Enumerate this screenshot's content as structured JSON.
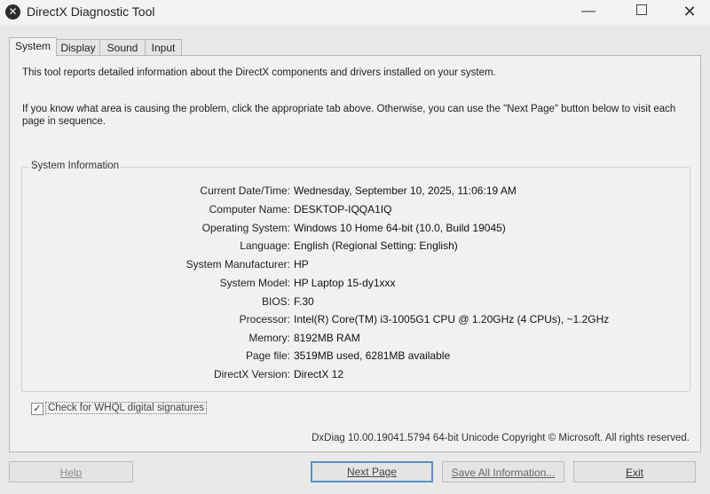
{
  "window": {
    "title": "DirectX Diagnostic Tool",
    "app_icon": "directx-x-icon",
    "controls": {
      "minimize": "—",
      "close": "✕"
    }
  },
  "tabs": [
    {
      "label": "System",
      "active": true
    },
    {
      "label": "Display",
      "active": false
    },
    {
      "label": "Sound",
      "active": false
    },
    {
      "label": "Input",
      "active": false
    }
  ],
  "intro": {
    "line1": "This tool reports detailed information about the DirectX components and drivers installed on your system.",
    "line2": "If you know what area is causing the problem, click the appropriate tab above.  Otherwise, you can use the \"Next Page\" button below to visit each page in sequence."
  },
  "system_info": {
    "group_label": "System Information",
    "rows": [
      {
        "label": "Current Date/Time:",
        "value": "Wednesday, September 10, 2025, 11:06:19 AM"
      },
      {
        "label": "Computer Name:",
        "value": "DESKTOP-IQQA1IQ"
      },
      {
        "label": "Operating System:",
        "value": "Windows 10 Home 64-bit (10.0, Build 19045)"
      },
      {
        "label": "Language:",
        "value": "English (Regional Setting: English)"
      },
      {
        "label": "System Manufacturer:",
        "value": "HP"
      },
      {
        "label": "System Model:",
        "value": "HP Laptop 15-dy1xxx"
      },
      {
        "label": "BIOS:",
        "value": "F.30"
      },
      {
        "label": "Processor:",
        "value": "Intel(R) Core(TM) i3-1005G1 CPU @ 1.20GHz (4 CPUs), ~1.2GHz"
      },
      {
        "label": "Memory:",
        "value": "8192MB RAM"
      },
      {
        "label": "Page file:",
        "value": "3519MB used, 6281MB available"
      },
      {
        "label": "DirectX Version:",
        "value": "DirectX 12"
      }
    ]
  },
  "whql": {
    "label": "Check for WHQL digital signatures",
    "checked": true,
    "check_mark": "✓"
  },
  "footer": {
    "copyright": "DxDiag 10.00.19041.5794 64-bit Unicode  Copyright © Microsoft. All rights reserved."
  },
  "buttons": {
    "help": "Help",
    "next_page": "Next Page",
    "save_all": "Save All Information...",
    "exit": "Exit"
  },
  "colors": {
    "accent_focus": "#5a8fc5",
    "window_bg": "#e9e9e7",
    "panel_bg": "#f1f1ef"
  }
}
